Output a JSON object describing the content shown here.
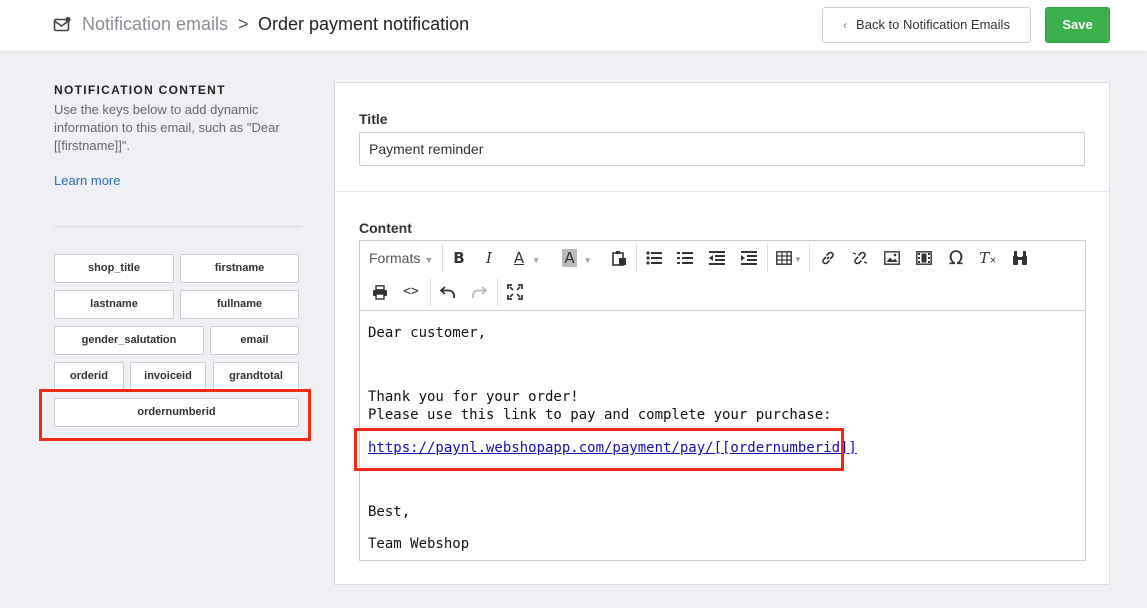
{
  "header": {
    "breadcrumb_parent": "Notification emails",
    "breadcrumb_separator": ">",
    "page_title": "Order payment notification",
    "back_button": "Back to Notification Emails",
    "save_button": "Save",
    "icons": {
      "breadcrumb": "mail-icon",
      "back": "chevron-left-icon"
    }
  },
  "sidebar": {
    "heading": "NOTIFICATION CONTENT",
    "description": "Use the keys below to add dynamic information to this email, such as \"Dear [[firstname]]\".",
    "learn_more": "Learn more",
    "keys": [
      "shop_title",
      "firstname",
      "lastname",
      "fullname",
      "gender_salutation",
      "email",
      "orderid",
      "invoiceid",
      "grandtotal",
      "ordernumberid"
    ],
    "highlighted_key": "ordernumberid"
  },
  "form": {
    "title_label": "Title",
    "title_value": "Payment reminder",
    "content_label": "Content",
    "toolbar": {
      "formats_label": "Formats",
      "row1_icons": [
        "bold-icon",
        "italic-icon",
        "text-color-icon",
        "background-color-icon",
        "paste-text-icon",
        "bullet-list-icon",
        "numbered-list-icon",
        "outdent-icon",
        "indent-icon",
        "table-icon",
        "link-icon",
        "unlink-icon",
        "image-icon",
        "media-icon",
        "special-character-icon",
        "clear-formatting-icon",
        "find-replace-icon"
      ],
      "row2_icons": [
        "print-icon",
        "source-code-icon",
        "undo-icon",
        "redo-icon",
        "fullscreen-icon"
      ]
    },
    "body": {
      "greeting": "Dear customer,",
      "thanks": "Thank you for your order!",
      "instruction": "Please use this link to pay and complete your purchase:",
      "link": "https://paynl.webshopapp.com/payment/pay/[[ordernumberid]]",
      "sign_off": "Best,",
      "signature": "Team Webshop"
    }
  },
  "colors": {
    "accent_green": "#3cb04b",
    "link_blue": "#2a6eb5",
    "highlight_red": "#ef2b16",
    "background": "#eef0f3"
  }
}
